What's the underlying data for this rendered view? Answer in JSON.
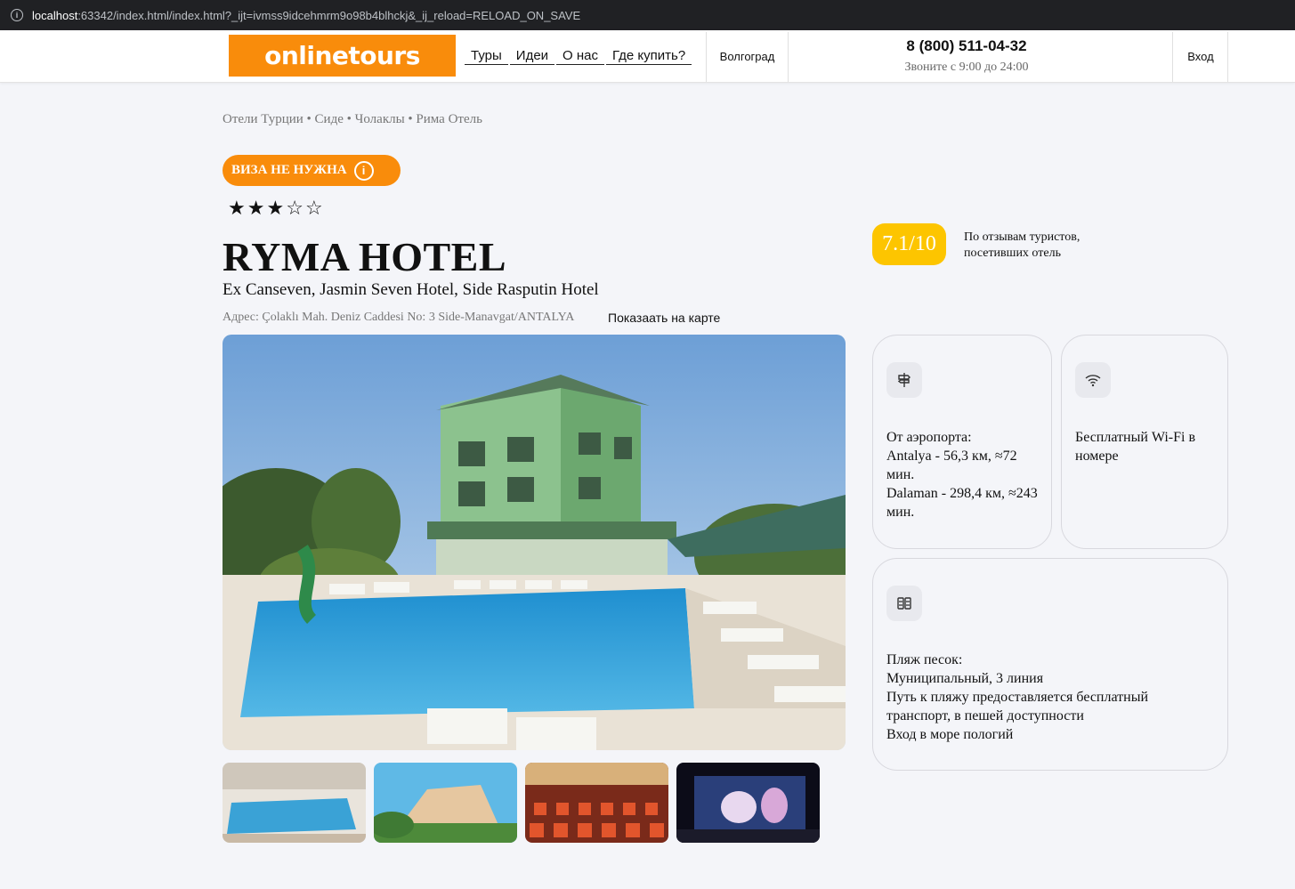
{
  "browser": {
    "url_host": "localhost",
    "url_rest": ":63342/index.html/index.html?_ijt=ivmss9idcehmrm9o98b4blhckj&_ij_reload=RELOAD_ON_SAVE"
  },
  "header": {
    "logo_text": "onlinetours",
    "nav": [
      "Туры",
      "Идеи",
      "О нас",
      "Где купить?"
    ],
    "city": "Волгоград",
    "phone": "8 (800) 511-04-32",
    "phone_hours": "Звоните с 9:00 до 24:00",
    "login": "Вход"
  },
  "breadcrumb": "Отели Турции • Сиде • Чолаклы • Рима Отель",
  "visa_badge": "ВИЗА НЕ НУЖНА",
  "stars": {
    "filled": 3,
    "total": 5
  },
  "hotel": {
    "title": "RYMA HOTEL",
    "subtitle": "Ex Canseven, Jasmin Seven Hotel, Side Rasputin Hotel",
    "address": "Адрес: Çolaklı Mah. Deniz Caddesi No: 3 Side-Manavgat/ANTALYA",
    "map_link": "Показаать на карте"
  },
  "rating": {
    "score": "7.1/10",
    "note": "По отзывам туристов, посетивших отель"
  },
  "cards": {
    "airport": {
      "icon": "signpost-icon",
      "lines": [
        "От аэропорта:",
        "Antalya - 56,3 км, ≈72 мин.",
        "Dalaman - 298,4 км, ≈243 мин."
      ]
    },
    "wifi": {
      "icon": "wifi-icon",
      "text": "Бесплатный Wi-Fi в номере"
    },
    "beach": {
      "icon": "beach-icon",
      "lines": [
        "Пляж песок:",
        "Муниципальный, 3 линия",
        "Путь к пляжу предоставляется бесплатный транспорт, в пешей доступности",
        "Вход в море пологий"
      ]
    }
  },
  "colors": {
    "brand_orange": "#f98c0b",
    "rating_yellow": "#fdc500"
  }
}
